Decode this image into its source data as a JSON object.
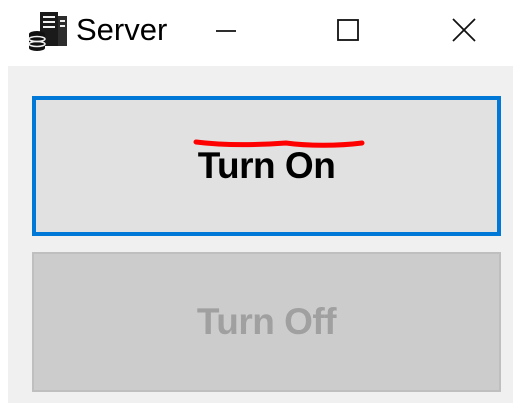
{
  "window": {
    "title": "Server",
    "app_icon": "server-icon",
    "controls": {
      "minimize_icon": "minimize-icon",
      "maximize_icon": "maximize-icon",
      "close_icon": "close-icon"
    }
  },
  "buttons": {
    "turn_on_label": "Turn On",
    "turn_off_label": "Turn Off",
    "turn_off_enabled": false
  },
  "colors": {
    "focus_border": "#0078d7",
    "annotation": "#ff0000",
    "client_bg": "#f0f0f0"
  }
}
